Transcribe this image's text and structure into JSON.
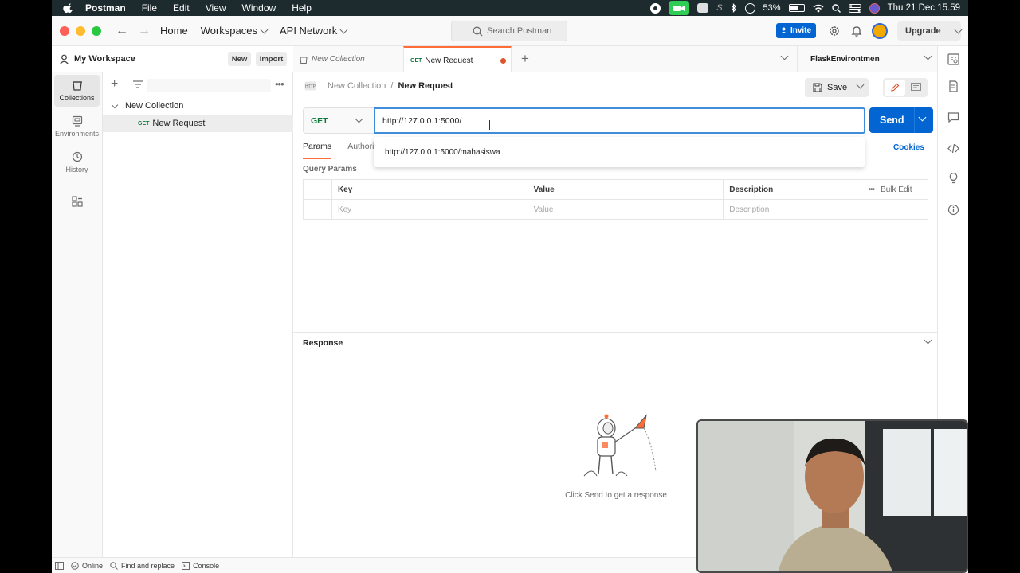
{
  "menubar": {
    "app": "Postman",
    "items": [
      "File",
      "Edit",
      "View",
      "Window",
      "Help"
    ],
    "battery": "53%",
    "datetime": "Thu 21 Dec  15.59"
  },
  "header": {
    "home": "Home",
    "workspaces": "Workspaces",
    "api_network": "API Network",
    "search_placeholder": "Search Postman",
    "invite": "Invite",
    "upgrade": "Upgrade"
  },
  "workspace": {
    "title": "My Workspace",
    "new_btn": "New",
    "import_btn": "Import"
  },
  "rail": {
    "collections": "Collections",
    "environments": "Environments",
    "history": "History"
  },
  "sidebar": {
    "collection": "New Collection",
    "request_method": "GET",
    "request_name": "New Request"
  },
  "tabs": {
    "tab1": "New Collection",
    "tab2_method": "GET",
    "tab2": "New Request",
    "environment": "FlaskEnvirontmen"
  },
  "request": {
    "breadcrumb_collection": "New Collection",
    "breadcrumb_sep": "/",
    "breadcrumb_request": "New Request",
    "save": "Save",
    "method": "GET",
    "url": "http://127.0.0.1:5000/",
    "send": "Send",
    "suggestion": "http://127.0.0.1:5000/mahasiswa",
    "tab_params": "Params",
    "tab_auth": "Authoriz",
    "cookies": "Cookies",
    "query_params": "Query Params",
    "col_key": "Key",
    "col_value": "Value",
    "col_description": "Description",
    "bulk_edit": "Bulk Edit",
    "ph_key": "Key",
    "ph_value": "Value",
    "ph_description": "Description"
  },
  "response": {
    "title": "Response",
    "empty_msg": "Click Send to get a response"
  },
  "status": {
    "online": "Online",
    "find_replace": "Find and replace",
    "console": "Console"
  },
  "colors": {
    "accent": "#ff6c37",
    "primary": "#0265d2",
    "get": "#0a7a3c"
  }
}
